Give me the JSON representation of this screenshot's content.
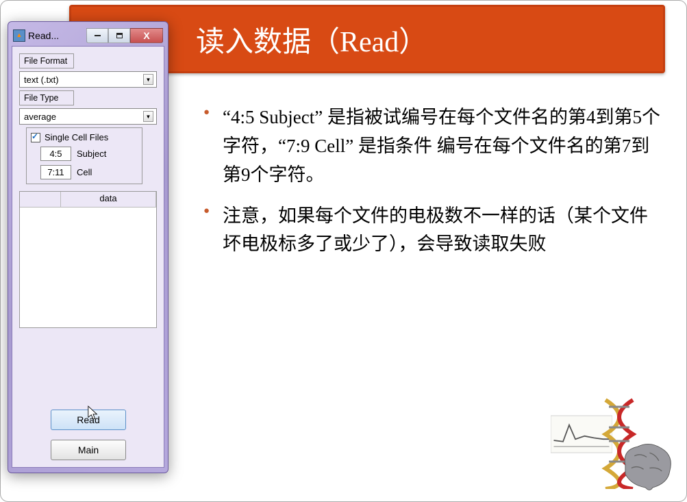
{
  "slide": {
    "title": "读入数据（Read）",
    "bullets": [
      "“4:5 Subject” 是指被试编号在每个文件名的第4到第5个字符，“7:9 Cell” 是指条件 编号在每个文件名的第7到第9个字符。",
      "注意，如果每个文件的电极数不一样的话（某个文件坏电极标多了或少了），会导致读取失败"
    ]
  },
  "window": {
    "title": "Read...",
    "labels": {
      "file_format": "File Format",
      "file_type": "File Type",
      "single_cell": "Single Cell Files",
      "subject": "Subject",
      "cell": "Cell",
      "data_col": "data"
    },
    "values": {
      "format": "text (.txt)",
      "type": "average",
      "subject_range": "4:5",
      "cell_range": "7:11",
      "single_cell_checked": true
    },
    "buttons": {
      "read": "Read",
      "main": "Main"
    }
  }
}
